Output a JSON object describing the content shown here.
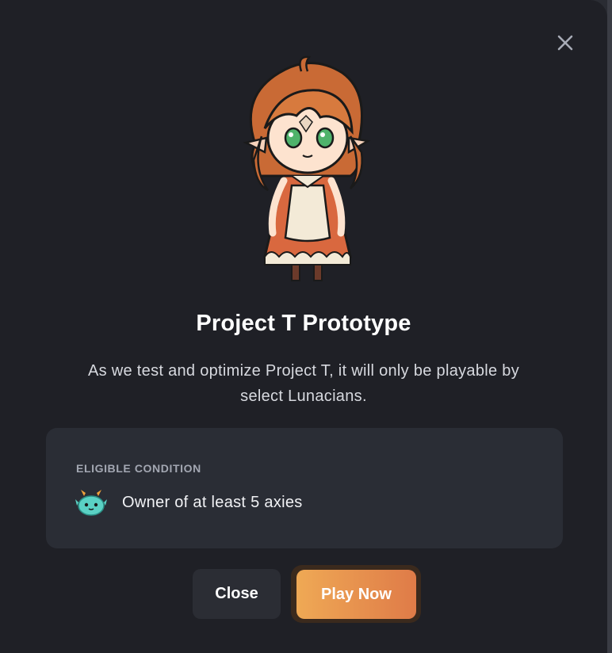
{
  "modal": {
    "title": "Project T Prototype",
    "description": "As we test and optimize Project T, it will only be playable by select Lunacians.",
    "condition": {
      "heading": "ELIGIBLE CONDITION",
      "text": "Owner of at least 5 axies",
      "icon": "axie-icon"
    },
    "buttons": {
      "close_label": "Close",
      "play_label": "Play Now"
    }
  },
  "colors": {
    "modal_bg": "#1f2026",
    "card_bg": "#2a2d35",
    "accent_start": "#efa955",
    "accent_end": "#df7b48"
  }
}
